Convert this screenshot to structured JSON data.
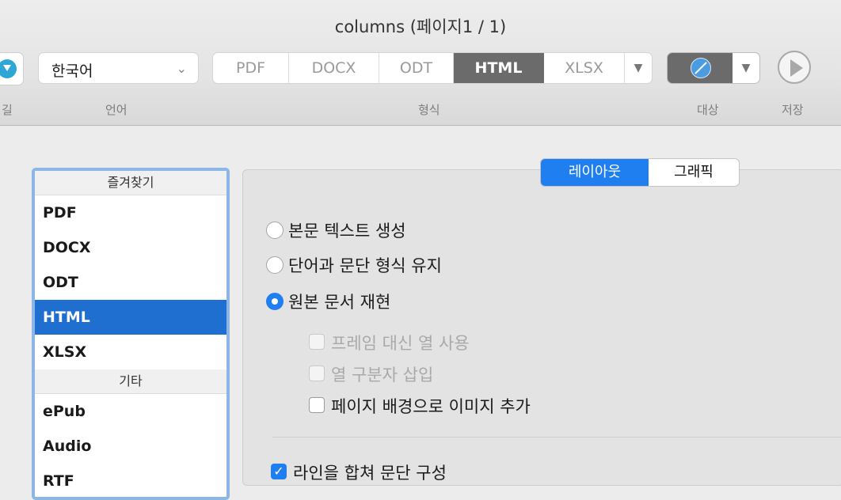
{
  "window": {
    "title": "columns (페이지1 / 1)"
  },
  "toolbar": {
    "download_label": "길",
    "language": {
      "value": "한국어",
      "label": "언어"
    },
    "format": {
      "options": [
        "PDF",
        "DOCX",
        "ODT",
        "HTML",
        "XLSX"
      ],
      "selected": "HTML",
      "label": "형식"
    },
    "target": {
      "label": "대상",
      "icon": "compass-icon"
    },
    "save": {
      "label": "저장",
      "icon": "play-icon"
    }
  },
  "sidebar": {
    "favorites_header": "즐겨찾기",
    "favorites": [
      "PDF",
      "DOCX",
      "ODT",
      "HTML",
      "XLSX"
    ],
    "selected": "HTML",
    "other_header": "기타",
    "other": [
      "ePub",
      "Audio",
      "RTF"
    ]
  },
  "panel": {
    "tabs": [
      "레이아웃",
      "그래픽"
    ],
    "active_tab": "레이아웃",
    "radios": [
      {
        "label": "본문 텍스트 생성",
        "checked": false
      },
      {
        "label": "단어과 문단 형식 유지",
        "checked": false
      },
      {
        "label": "원본 문서 재현",
        "checked": true
      }
    ],
    "sub_options": [
      {
        "label": "프레임 대신 열 사용",
        "checked": false,
        "enabled": false
      },
      {
        "label": "열 구분자 삽입",
        "checked": false,
        "enabled": false
      },
      {
        "label": "페이지 배경으로 이미지 추가",
        "checked": false,
        "enabled": true
      }
    ],
    "merge_lines": {
      "label": "라인을 합쳐 문단 구성",
      "checked": true
    }
  },
  "colors": {
    "accent": "#1f7ff0",
    "selection": "#1f6fd1",
    "segment_active": "#6b6b6b"
  }
}
